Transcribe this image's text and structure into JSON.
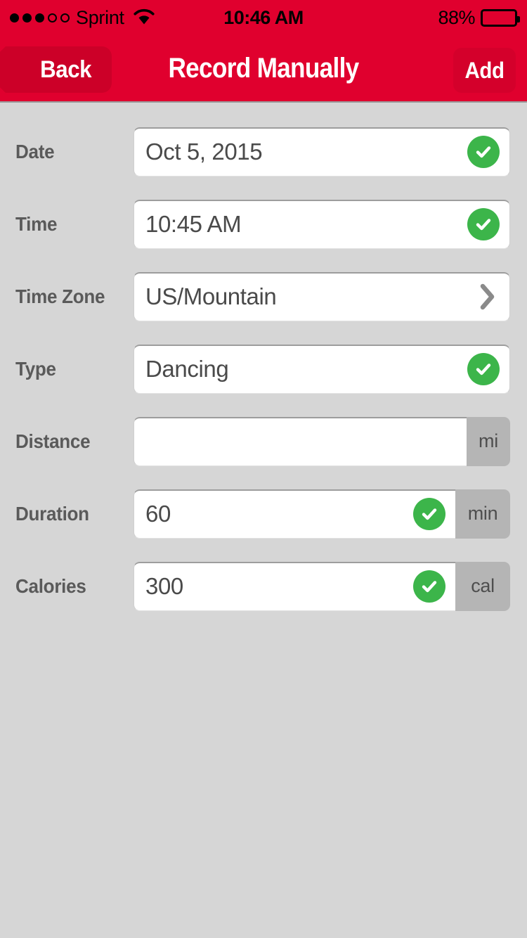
{
  "status_bar": {
    "carrier": "Sprint",
    "signal_dots_filled": 3,
    "signal_dots_total": 5,
    "wifi_icon": "wifi-icon",
    "time": "10:46 AM",
    "battery_percent": "88%",
    "battery_level": 88
  },
  "nav": {
    "back_label": "Back",
    "title": "Record Manually",
    "add_label": "Add"
  },
  "colors": {
    "brand_red": "#e0002e",
    "back_button_red": "#cc0028",
    "add_button_red": "#d4002b",
    "page_background": "#d6d6d6",
    "check_green": "#3cb54a",
    "unit_gray": "#b5b5b5",
    "label_gray": "#5a5a5a"
  },
  "form": {
    "rows": [
      {
        "label": "Date",
        "value": "Oct 5, 2015",
        "placeholder": "",
        "unit": "",
        "accessory": "check",
        "accessory_icon": "check-circle-icon"
      },
      {
        "label": "Time",
        "value": "10:45 AM",
        "placeholder": "",
        "unit": "",
        "accessory": "check",
        "accessory_icon": "check-circle-icon"
      },
      {
        "label": "Time Zone",
        "value": "US/Mountain",
        "placeholder": "",
        "unit": "",
        "accessory": "chevron",
        "accessory_icon": "chevron-right-icon"
      },
      {
        "label": "Type",
        "value": "Dancing",
        "placeholder": "",
        "unit": "",
        "accessory": "check",
        "accessory_icon": "check-circle-icon"
      },
      {
        "label": "Distance",
        "value": "",
        "placeholder": "",
        "unit": "mi",
        "accessory": "none",
        "accessory_icon": ""
      },
      {
        "label": "Duration",
        "value": "60",
        "placeholder": "",
        "unit": "min",
        "accessory": "check",
        "accessory_icon": "check-circle-icon"
      },
      {
        "label": "Calories",
        "value": "300",
        "placeholder": "",
        "unit": "cal",
        "accessory": "check",
        "accessory_icon": "check-circle-icon"
      }
    ]
  }
}
